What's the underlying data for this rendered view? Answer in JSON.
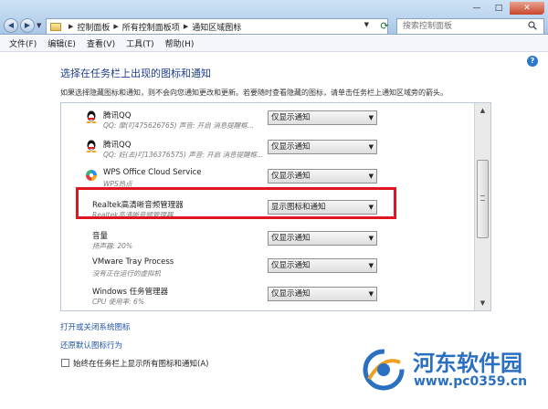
{
  "window": {
    "controls": {
      "minimize": "—",
      "maximize": "□",
      "close": "✕"
    }
  },
  "address_bar": {
    "breadcrumbs": [
      "控制面板",
      "所有控制面板项",
      "通知区域图标"
    ],
    "search_placeholder": "搜索控制面板"
  },
  "menu": {
    "items": [
      "文件(F)",
      "编辑(E)",
      "查看(V)",
      "工具(T)",
      "帮助(H)"
    ]
  },
  "main": {
    "title": "选择在任务栏上出现的图标和通知",
    "description": "如果选择隐藏图标和通知，则不会向您通知更改和更新。若要随时查看隐藏的图标，请单击任务栏上通知区域旁的箭头。",
    "rows": [
      {
        "name": "腾讯QQ",
        "sub": "QQ: 摩(叮475626765)  声音: 开启  消息提醒框...",
        "behavior": "仅显示通知",
        "icon": "qq-penguin-icon"
      },
      {
        "name": "腾讯QQ",
        "sub": "QQ: 妊(去)叮136376575)  声音: 开启  消息提醒框...",
        "behavior": "仅显示通知",
        "icon": "qq-penguin-icon"
      },
      {
        "name": "WPS Office Cloud Service",
        "sub": "WPS热点",
        "behavior": "仅显示通知",
        "icon": "wps-cloud-icon"
      },
      {
        "name": "Realtek高清晰音频管理器",
        "sub": "Realtek高清晰音频管理器",
        "behavior": "显示图标和通知",
        "icon": ""
      },
      {
        "name": "音量",
        "sub": "扬声器: 20%",
        "behavior": "仅显示通知",
        "icon": ""
      },
      {
        "name": "VMware Tray Process",
        "sub": "没有正在运行的虚拟机",
        "behavior": "仅显示通知",
        "icon": ""
      },
      {
        "name": "Windows 任务管理器",
        "sub": "CPU 使用率: 6%",
        "behavior": "仅显示通知",
        "icon": ""
      }
    ],
    "links": {
      "system_icons": "打开或关闭系统图标",
      "restore": "还原默认图标行为"
    },
    "always_show_label": "始终在任务栏上显示所有图标和通知(A)"
  },
  "watermark": {
    "name": "河东软件园",
    "url": "www.pc0359.cn"
  },
  "colors": {
    "title_blue": "#1e3d8f",
    "link_blue": "#1f54a8",
    "highlight_red": "#e0161e",
    "watermark_blue": "#2a6fc0"
  }
}
